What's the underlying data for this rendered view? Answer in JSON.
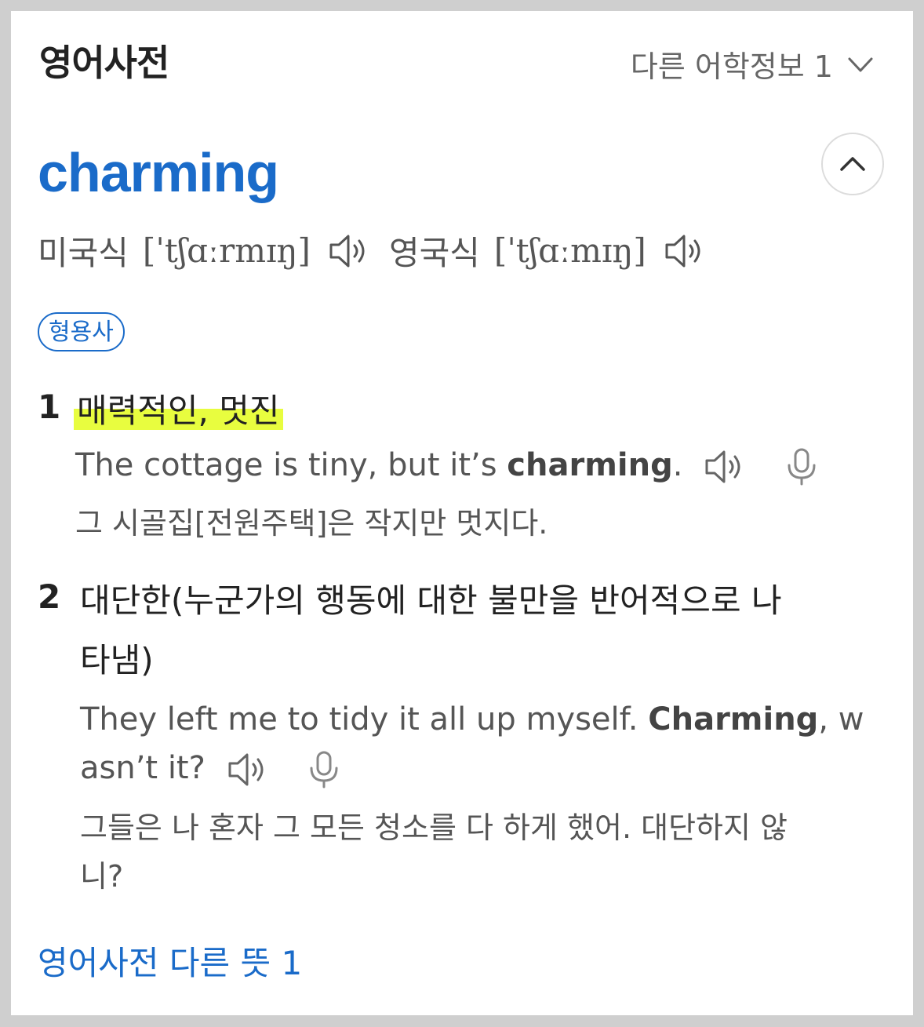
{
  "header": {
    "title": "영어사전",
    "other_info": "다른 어학정보 1"
  },
  "entry": {
    "word": "charming",
    "us_label": "미국식",
    "us_ipa": "[ˈtʃɑːrmɪŋ]",
    "uk_label": "영국식",
    "uk_ipa": "[ˈtʃɑːmɪŋ]",
    "pos": "형용사"
  },
  "senses": [
    {
      "num": "1",
      "meaning": "매력적인, 멋진",
      "ex_pre": "The cottage is tiny, but it’s ",
      "ex_bold": "charming",
      "ex_post": ".",
      "ko": "그 시골집[전원주택]은 작지만 멋지다."
    },
    {
      "num": "2",
      "meaning_line1": "대단한(누군가의 행동에 대한 불만을 반어적으로 나",
      "meaning_line2": "타냄)",
      "ex_pre": "They left me to tidy it all up myself. ",
      "ex_bold": "Charming",
      "ex_post1": ", w",
      "ex_post2": "asn’t it?",
      "ko_line1": "그들은 나 혼자 그 모든 청소를 다 하게 했어. 대단하지 않",
      "ko_line2": "니?"
    }
  ],
  "footer": {
    "more_link": "영어사전 다른 뜻 1"
  },
  "icons": {
    "speaker": "speaker-icon",
    "mic": "microphone-icon",
    "chevron_down": "chevron-down-icon",
    "chevron_up": "chevron-up-icon"
  },
  "colors": {
    "accent": "#1a6bc9",
    "highlight": "#e8fd3f"
  }
}
